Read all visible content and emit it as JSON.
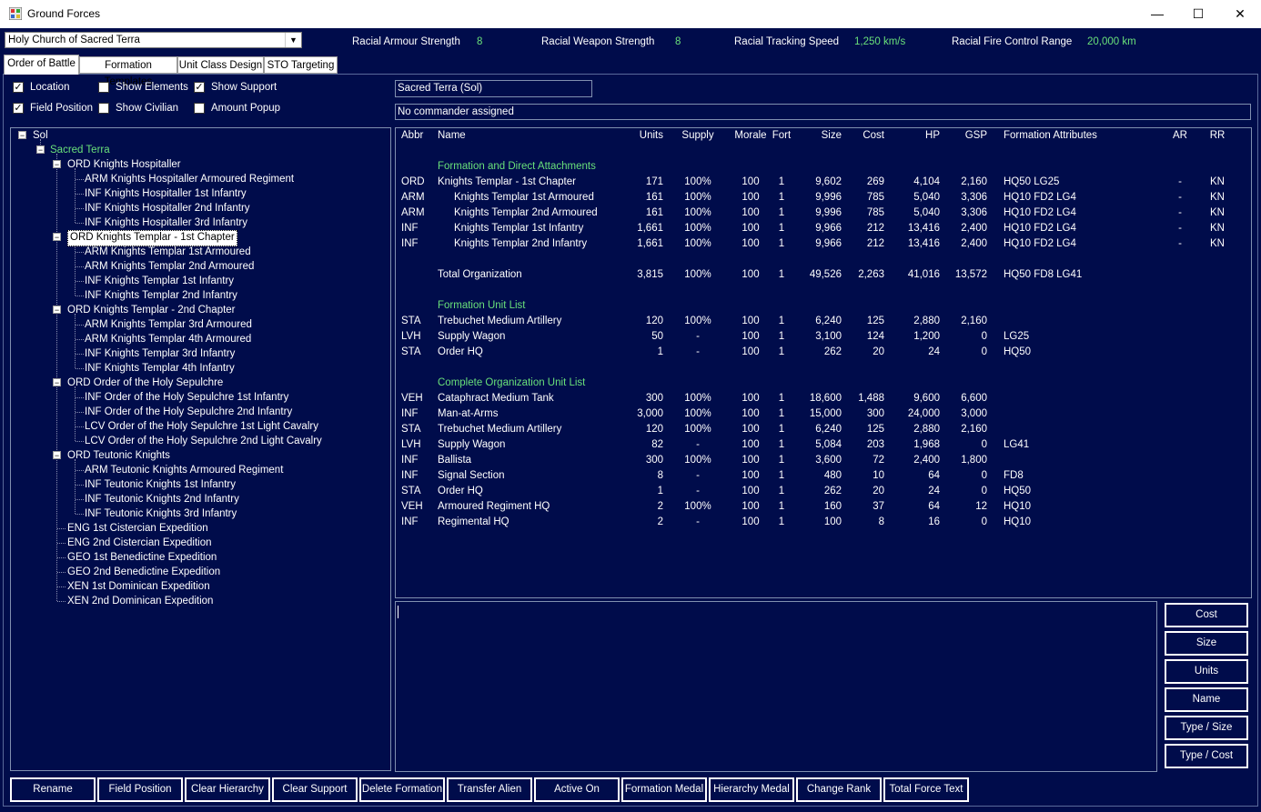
{
  "window": {
    "title": "Ground Forces",
    "minimize": "—",
    "maximize": "☐",
    "close": "✕"
  },
  "race_select": {
    "value": "Holy Church of Sacred Terra"
  },
  "stats": {
    "armour_label": "Racial Armour Strength",
    "armour_value": "8",
    "weapon_label": "Racial Weapon Strength",
    "weapon_value": "8",
    "tracking_label": "Racial Tracking Speed",
    "tracking_value": "1,250 km/s",
    "firecontrol_label": "Racial Fire Control Range",
    "firecontrol_value": "20,000 km"
  },
  "tabs": [
    "Order of Battle",
    "Formation Templates",
    "Unit Class Design",
    "STO Targeting"
  ],
  "options": {
    "location": {
      "label": "Location",
      "checked": true
    },
    "show_elements": {
      "label": "Show Elements",
      "checked": false
    },
    "show_support": {
      "label": "Show Support",
      "checked": true
    },
    "field_position": {
      "label": "Field Position",
      "checked": true
    },
    "show_civilian": {
      "label": "Show Civilian",
      "checked": false
    },
    "amount_popup": {
      "label": "Amount Popup",
      "checked": false
    }
  },
  "tree": {
    "root": "Sol",
    "planet": "Sacred Terra",
    "nodes": [
      "ORD Knights Hospitaller",
      "ARM Knights Hospitaller Armoured Regiment",
      "INF Knights Hospitaller 1st Infantry",
      "INF Knights Hospitaller 2nd Infantry",
      "INF Knights Hospitaller 3rd Infantry",
      "ORD Knights Templar - 1st Chapter",
      "ARM Knights Templar 1st Armoured",
      "ARM Knights Templar 2nd Armoured",
      "INF Knights Templar 1st Infantry",
      "INF Knights Templar 2nd Infantry",
      "ORD Knights Templar - 2nd Chapter",
      "ARM Knights Templar 3rd Armoured",
      "ARM Knights Templar 4th Armoured",
      "INF Knights Templar 3rd Infantry",
      "INF Knights Templar 4th Infantry",
      "ORD Order of the Holy Sepulchre",
      "INF Order of the Holy Sepulchre 1st Infantry",
      "INF Order of the Holy Sepulchre 2nd Infantry",
      "LCV Order of the Holy Sepulchre 1st Light Cavalry",
      "LCV Order of the Holy Sepulchre 2nd Light Cavalry",
      "ORD Teutonic Knights",
      "ARM Teutonic Knights Armoured Regiment",
      "INF Teutonic Knights 1st Infantry",
      "INF Teutonic Knights 2nd Infantry",
      "INF Teutonic Knights 3rd Infantry",
      "ENG 1st Cistercian Expedition",
      "ENG 2nd Cistercian Expedition",
      "GEO 1st Benedictine Expedition",
      "GEO 2nd Benedictine Expedition",
      "XEN 1st Dominican Expedition",
      "XEN 2nd Dominican Expedition"
    ]
  },
  "location_field": "Sacred Terra  (Sol)",
  "commander_field": "No commander assigned",
  "grid": {
    "headers": [
      "Abbr",
      "Name",
      "Units",
      "Supply",
      "Morale",
      "Fort",
      "Size",
      "Cost",
      "HP",
      "GSP",
      "Formation Attributes",
      "AR",
      "RR"
    ],
    "sections": [
      "Formation and Direct Attachments",
      "Formation Unit List",
      "Complete Organization Unit List"
    ],
    "attachments": [
      [
        "ORD",
        "Knights Templar - 1st Chapter",
        "171",
        "100%",
        "100",
        "1",
        "9,602",
        "269",
        "4,104",
        "2,160",
        "HQ50  LG25",
        "-",
        "KN"
      ],
      [
        "ARM",
        "Knights Templar 1st Armoured",
        "161",
        "100%",
        "100",
        "1",
        "9,996",
        "785",
        "5,040",
        "3,306",
        "HQ10  FD2  LG4",
        "-",
        "KN"
      ],
      [
        "ARM",
        "Knights Templar 2nd Armoured",
        "161",
        "100%",
        "100",
        "1",
        "9,996",
        "785",
        "5,040",
        "3,306",
        "HQ10  FD2  LG4",
        "-",
        "KN"
      ],
      [
        "INF",
        "Knights Templar 1st Infantry",
        "1,661",
        "100%",
        "100",
        "1",
        "9,966",
        "212",
        "13,416",
        "2,400",
        "HQ10  FD2  LG4",
        "-",
        "KN"
      ],
      [
        "INF",
        "Knights Templar 2nd Infantry",
        "1,661",
        "100%",
        "100",
        "1",
        "9,966",
        "212",
        "13,416",
        "2,400",
        "HQ10  FD2  LG4",
        "-",
        "KN"
      ]
    ],
    "total": [
      "",
      "Total Organization",
      "3,815",
      "100%",
      "100",
      "1",
      "49,526",
      "2,263",
      "41,016",
      "13,572",
      "HQ50  FD8  LG41",
      "",
      ""
    ],
    "unit_list": [
      [
        "STA",
        "Trebuchet Medium Artillery",
        "120",
        "100%",
        "100",
        "1",
        "6,240",
        "125",
        "2,880",
        "2,160",
        "",
        "",
        ""
      ],
      [
        "LVH",
        "Supply Wagon",
        "50",
        "-",
        "100",
        "1",
        "3,100",
        "124",
        "1,200",
        "0",
        "LG25",
        "",
        ""
      ],
      [
        "STA",
        "Order HQ",
        "1",
        "-",
        "100",
        "1",
        "262",
        "20",
        "24",
        "0",
        "HQ50",
        "",
        ""
      ]
    ],
    "complete_list": [
      [
        "VEH",
        "Cataphract Medium Tank",
        "300",
        "100%",
        "100",
        "1",
        "18,600",
        "1,488",
        "9,600",
        "6,600",
        "",
        "",
        ""
      ],
      [
        "INF",
        "Man-at-Arms",
        "3,000",
        "100%",
        "100",
        "1",
        "15,000",
        "300",
        "24,000",
        "3,000",
        "",
        "",
        ""
      ],
      [
        "STA",
        "Trebuchet Medium Artillery",
        "120",
        "100%",
        "100",
        "1",
        "6,240",
        "125",
        "2,880",
        "2,160",
        "",
        "",
        ""
      ],
      [
        "LVH",
        "Supply Wagon",
        "82",
        "-",
        "100",
        "1",
        "5,084",
        "203",
        "1,968",
        "0",
        "LG41",
        "",
        ""
      ],
      [
        "INF",
        "Ballista",
        "300",
        "100%",
        "100",
        "1",
        "3,600",
        "72",
        "2,400",
        "1,800",
        "",
        "",
        ""
      ],
      [
        "INF",
        "Signal Section",
        "8",
        "-",
        "100",
        "1",
        "480",
        "10",
        "64",
        "0",
        "FD8",
        "",
        ""
      ],
      [
        "STA",
        "Order HQ",
        "1",
        "-",
        "100",
        "1",
        "262",
        "20",
        "24",
        "0",
        "HQ50",
        "",
        ""
      ],
      [
        "VEH",
        "Armoured Regiment HQ",
        "2",
        "100%",
        "100",
        "1",
        "160",
        "37",
        "64",
        "12",
        "HQ10",
        "",
        ""
      ],
      [
        "INF",
        "Regimental HQ",
        "2",
        "-",
        "100",
        "1",
        "100",
        "8",
        "16",
        "0",
        "HQ10",
        "",
        ""
      ]
    ]
  },
  "sort_buttons": [
    "Cost",
    "Size",
    "Units",
    "Name",
    "Type / Size",
    "Type / Cost"
  ],
  "bottom_buttons": [
    "Rename",
    "Field Position",
    "Clear Hierarchy",
    "Clear Support",
    "Delete Formation",
    "Transfer Alien",
    "Active On",
    "Formation Medal",
    "Hierarchy Medal",
    "Change Rank",
    "Total Force Text"
  ]
}
